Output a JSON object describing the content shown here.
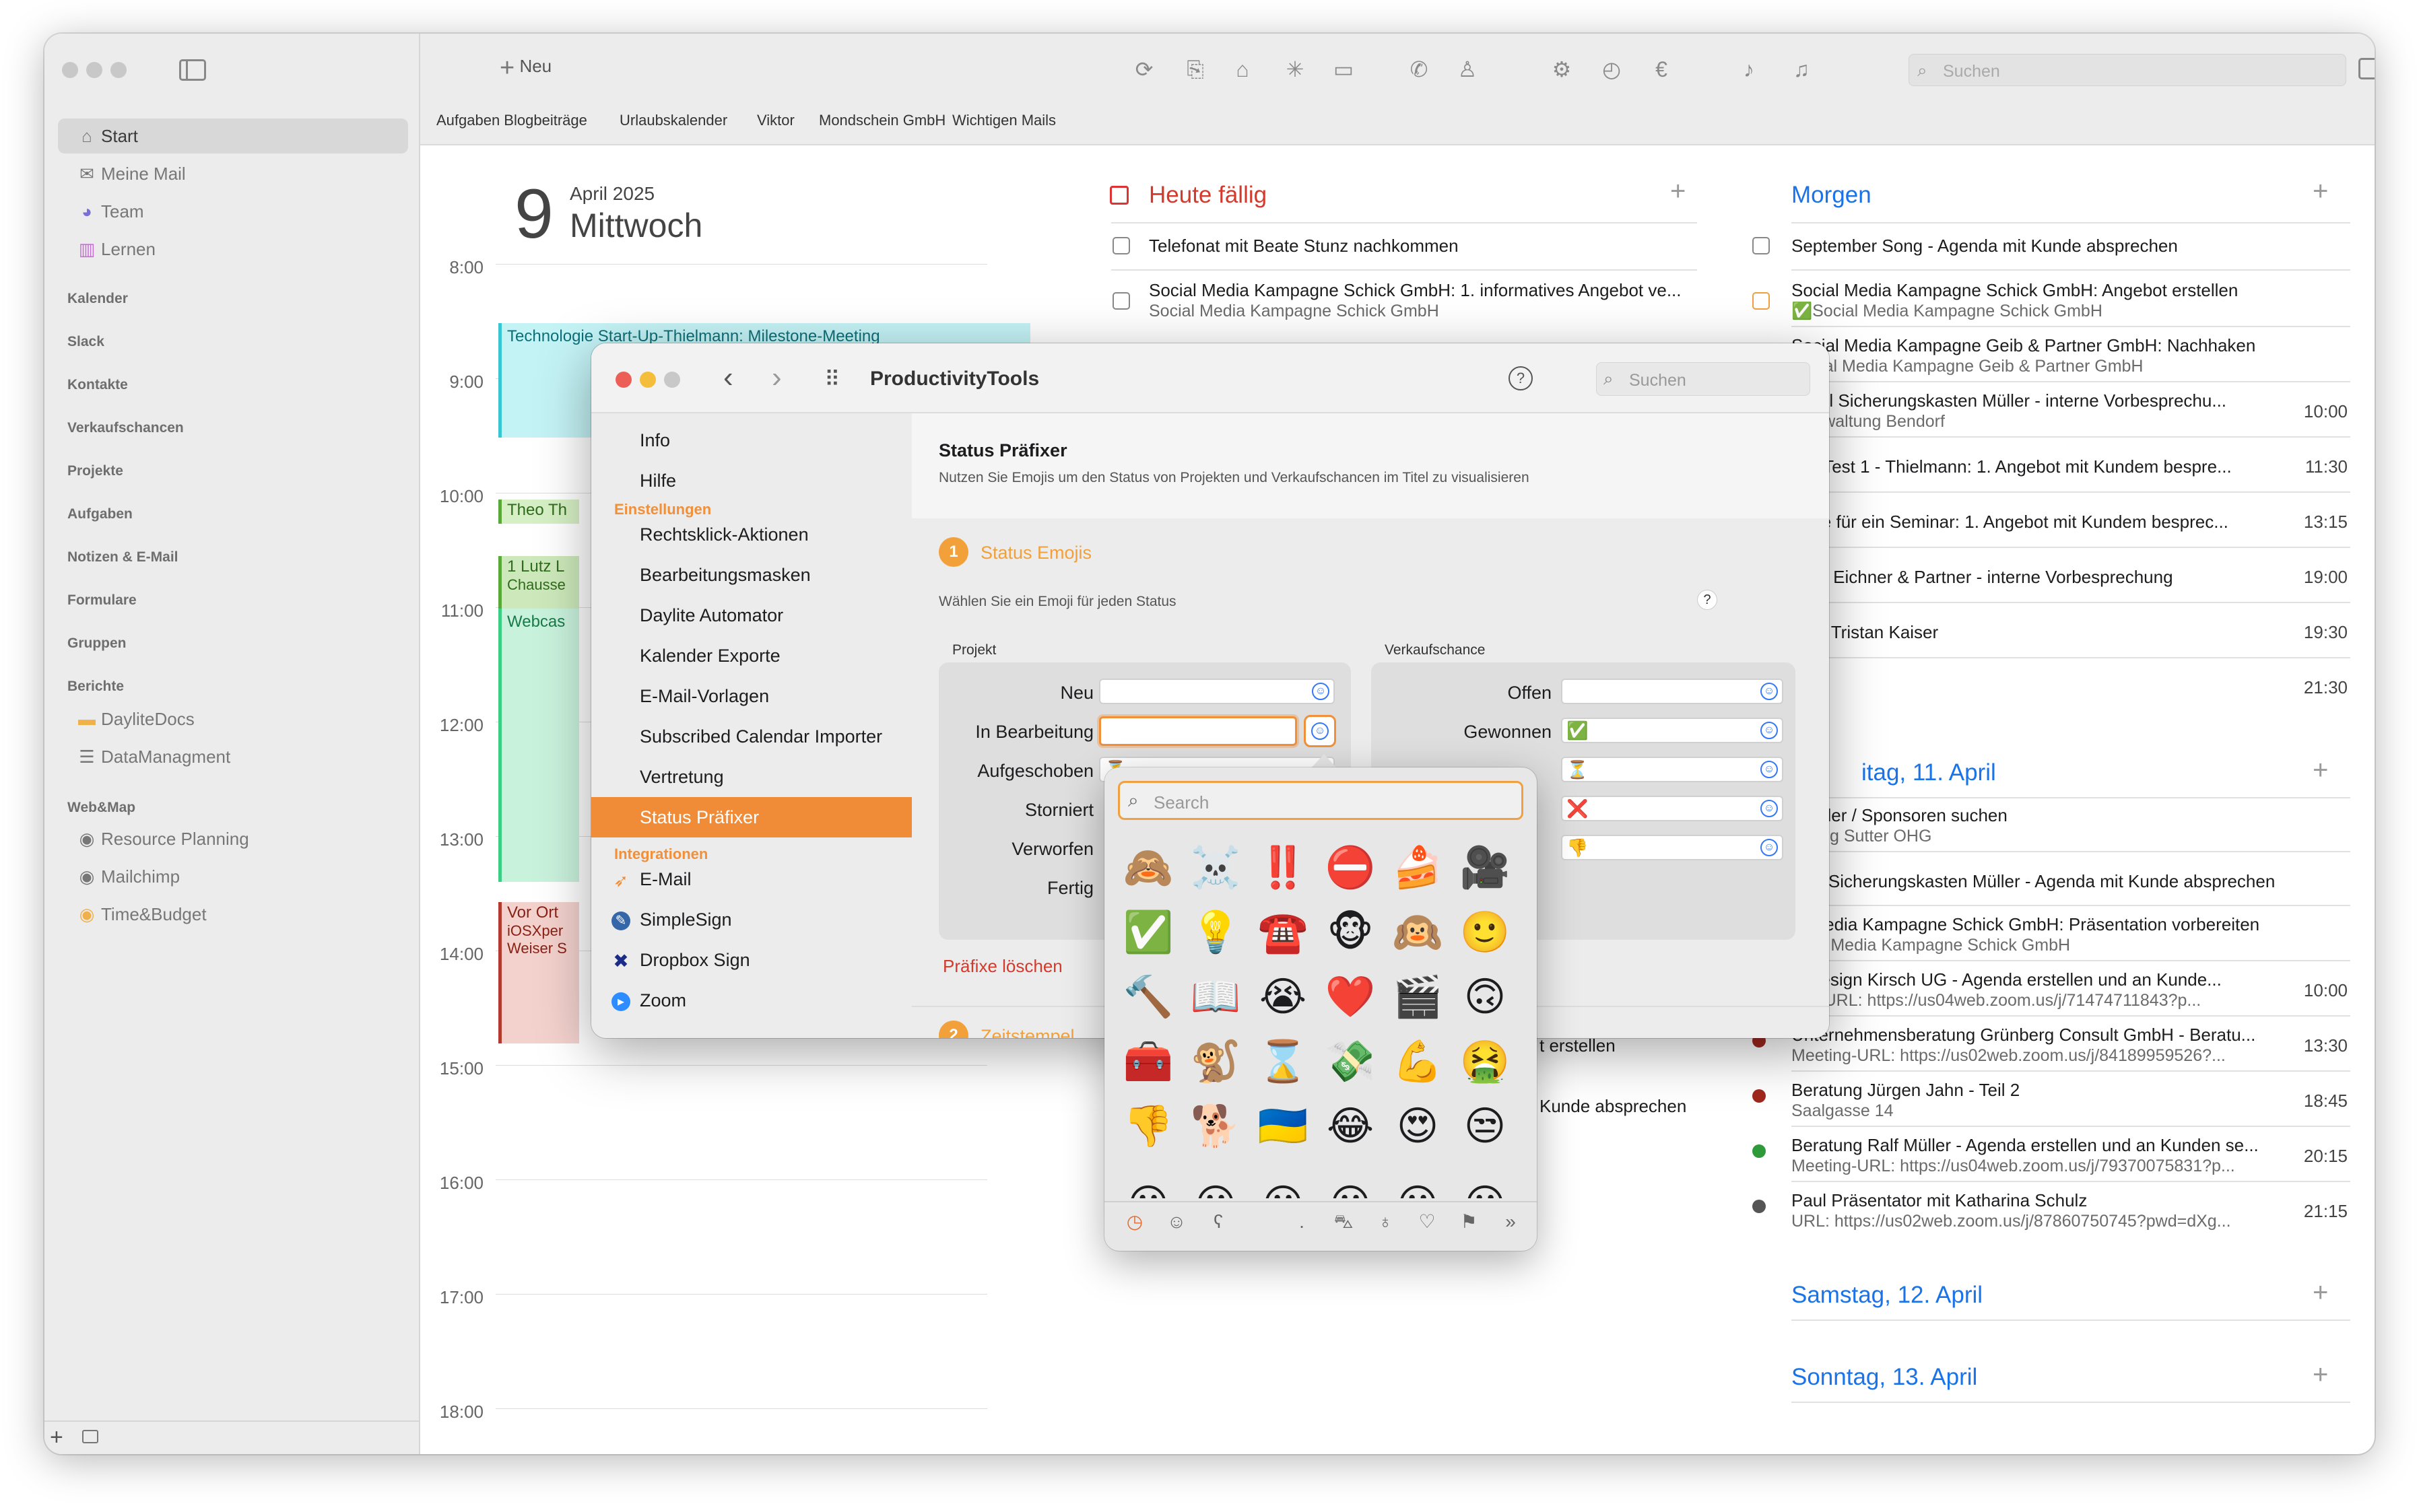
{
  "toolbar": {
    "new_label": "Neu",
    "search_placeholder": "Suchen"
  },
  "favorites": [
    "Aufgaben Blogbeiträge",
    "Urlaubskalender",
    "Viktor",
    "Mondschein GmbH",
    "Wichtigen Mails"
  ],
  "sidebar": {
    "items": [
      {
        "label": "Start",
        "icon": "house-icon"
      },
      {
        "label": "Meine Mail",
        "icon": "envelope-icon"
      },
      {
        "label": "Team",
        "icon": "team-icon"
      },
      {
        "label": "Lernen",
        "icon": "books-icon"
      }
    ],
    "sections": [
      "Kalender",
      "Slack",
      "Kontakte",
      "Verkaufschancen",
      "Projekte",
      "Aufgaben",
      "Notizen & E-Mail",
      "Formulare",
      "Gruppen",
      "Berichte"
    ],
    "reports": [
      "DayliteDocs",
      "DataManagment"
    ],
    "webmap_title": "Web&Map",
    "webmap": [
      "Resource Planning",
      "Mailchimp",
      "Time&Budget"
    ]
  },
  "calendar": {
    "day_number": "9",
    "month_year": "April 2025",
    "weekday": "Mittwoch",
    "hours": [
      "8:00",
      "9:00",
      "10:00",
      "11:00",
      "12:00",
      "13:00",
      "14:00",
      "15:00",
      "16:00",
      "17:00",
      "18:00"
    ],
    "events": [
      {
        "title": "Technologie Start-Up-Thielmann: Milestone-Meeting"
      },
      {
        "title": "Theo Th"
      },
      {
        "title": "1 Lutz L",
        "sub": "Chausse"
      },
      {
        "title": "Webcas"
      },
      {
        "title": "Vor Ort",
        "sub": "iOSXper",
        "sub2": "Weiser S"
      }
    ]
  },
  "today": {
    "title": "Heute fällig",
    "tasks": [
      {
        "title": "Telefonat mit Beate Stunz nachkommen"
      },
      {
        "title": "Social Media Kampagne Schick GmbH: 1. informatives Angebot ve...",
        "sub": "Social Media Kampagne Schick GmbH"
      }
    ],
    "partial": [
      "t erstellen",
      "Kunde absprechen"
    ]
  },
  "tomorrow": {
    "title": "Morgen",
    "items": [
      {
        "title": "September Song - Agenda mit Kunde absprechen",
        "time": ""
      },
      {
        "title": "Social Media Kampagne Schick GmbH: Angebot erstellen",
        "sub": "✅Social Media Kampagne Schick GmbH",
        "time": ""
      },
      {
        "title": "Social Media Kampagne Geib & Partner GmbH: Nachhaken",
        "sub": "Social Media Kampagne Geib & Partner GmbH",
        "time": ""
      },
      {
        "title": "ehsel Sicherungskasten Müller - interne Vorbesprechu...",
        "sub": "ltverwaltung Bendorf",
        "time": "10:00"
      },
      {
        "title": "rbill Test 1 - Thielmann: 1. Angebot mit Kundem bespre...",
        "time": "11:30"
      },
      {
        "title": "frage für ein Seminar: 1. Angebot mit Kundem besprec...",
        "time": "13:15"
      },
      {
        "title": "seite Eichner & Partner - interne Vorbesprechung",
        "time": "19:00"
      },
      {
        "title": "from Tristan Kaiser",
        "time": "19:30"
      },
      {
        "title": "",
        "time": "21:30"
      }
    ]
  },
  "friday": {
    "title": "itag, 11. April",
    "items": [
      {
        "title": "ssteller / Sponsoren suchen",
        "sub": "ratung Sutter OHG",
        "time": ""
      },
      {
        "title": "hsel Sicherungskasten Müller - Agenda mit Kunde absprechen",
        "time": ""
      },
      {
        "title": "al Media Kampagne Schick GmbH: Präsentation vorbereiten",
        "sub": "ocial Media Kampagne Schick GmbH",
        "time": ""
      },
      {
        "title": "godesign Kirsch UG - Agenda erstellen und an Kunde...",
        "sub": "ting-URL: https://us04web.zoom.us/j/71474711843?p...",
        "time": "10:00"
      },
      {
        "title": "Unternehmensberatung Grünberg Consult GmbH - Beratu...",
        "sub": "Meeting-URL: https://us02web.zoom.us/j/84189959526?...",
        "time": "13:30",
        "dot": "#a0281e"
      },
      {
        "title": "Beratung Jürgen Jahn - Teil 2",
        "sub": "Saalgasse 14",
        "time": "18:45",
        "dot": "#a0281e"
      },
      {
        "title": "Beratung Ralf Müller - Agenda erstellen und an Kunden se...",
        "sub": "Meeting-URL: https://us04web.zoom.us/j/79370075831?p...",
        "time": "20:15",
        "dot": "#2e9a3a"
      },
      {
        "title": "Paul Präsentator mit Katharina Schulz",
        "sub": "URL: https://us02web.zoom.us/j/87860750745?pwd=dXg...",
        "time": "21:15",
        "dot": "#555555"
      }
    ]
  },
  "saturday": {
    "title": "Samstag, 12. April"
  },
  "sunday": {
    "title": "Sonntag, 13. April"
  },
  "productivity": {
    "title": "ProductivityTools",
    "search_placeholder": "Suchen",
    "help": "?",
    "nav": [
      {
        "label": "Info"
      },
      {
        "label": "Hilfe"
      }
    ],
    "settings_title": "Einstellungen",
    "settings": [
      "Rechtsklick-Aktionen",
      "Bearbeitungsmasken",
      "Daylite Automator",
      "Kalender Exporte",
      "E-Mail-Vorlagen",
      "Subscribed Calendar Importer",
      "Vertretung",
      "Status Präfixer"
    ],
    "integrations_title": "Integrationen",
    "integrations": [
      "E-Mail",
      "SimpleSign",
      "Dropbox Sign",
      "Zoom"
    ],
    "main_title": "Status Präfixer",
    "main_desc": "Nutzen Sie Emojis um den Status von Projekten und Verkaufschancen im Titel zu visualisieren",
    "step_number": "1",
    "step_title": "Status Emojis",
    "step_desc": "Wählen Sie ein Emoji für jeden Status",
    "step_help": "?",
    "project_title": "Projekt",
    "project_rows": [
      {
        "label": "Neu",
        "value": ""
      },
      {
        "label": "In Bearbeitung",
        "value": ""
      },
      {
        "label": "Aufgeschoben",
        "value": "⏳"
      },
      {
        "label": "Storniert",
        "value": ""
      },
      {
        "label": "Verworfen",
        "value": ""
      },
      {
        "label": "Fertig",
        "value": ""
      }
    ],
    "opp_title": "Verkaufschance",
    "opp_rows": [
      {
        "label": "Offen",
        "value": ""
      },
      {
        "label": "Gewonnen",
        "value": "✅"
      },
      {
        "label": "",
        "value": "⏳"
      },
      {
        "label": "",
        "value": "❌"
      },
      {
        "label": "",
        "value": "👎"
      }
    ],
    "clear_label": "Präfixe löschen",
    "step2_number": "2",
    "step2_title": "Zeitstempel"
  },
  "emoji_picker": {
    "search_placeholder": "Search",
    "emojis": [
      "🙈",
      "☠️",
      "‼️",
      "⛔",
      "🍰",
      "🎥",
      "✅",
      "💡",
      "☎️",
      "🐵",
      "🙉",
      "🙂",
      "🔨",
      "📖",
      "😭",
      "❤️",
      "🎬",
      "🙃",
      "🧰",
      "🐒",
      "⌛",
      "💸",
      "💪",
      "🤮",
      "👎",
      "🐕",
      "🇺🇦",
      "😂",
      "😍",
      "😒"
    ],
    "categories": [
      "clock-icon",
      "smiley-icon",
      "bear-icon",
      "apple-icon",
      "ball-icon",
      "car-icon",
      "bulb-icon",
      "heart-icon",
      "flag-icon",
      "more-icon"
    ],
    "category_glyphs": [
      "◷",
      "☺",
      "ʕ",
      "",
      ".",
      "⛍",
      "♁",
      "♡",
      "⚑",
      "»"
    ]
  }
}
